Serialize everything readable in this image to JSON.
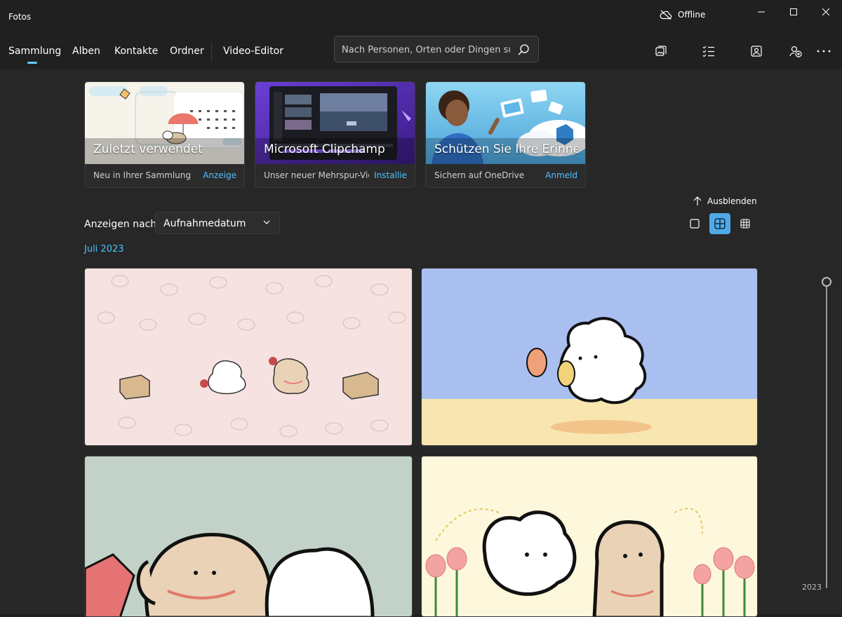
{
  "app": {
    "title": "Fotos",
    "status": "Offline"
  },
  "nav": {
    "tabs": [
      {
        "label": "Sammlung"
      },
      {
        "label": "Alben"
      },
      {
        "label": "Kontakte"
      },
      {
        "label": "Ordner"
      },
      {
        "label": "Video-Editor"
      }
    ],
    "active_tab": "Sammlung"
  },
  "search": {
    "placeholder": "Nach Personen, Orten oder Dingen su"
  },
  "toolbar": {
    "icons": [
      "import-icon",
      "select-icon",
      "people-icon",
      "onedrive-add-icon",
      "more-icon"
    ]
  },
  "cards": [
    {
      "title": "Zuletzt verwendet",
      "subtitle": "Neu in Ihrer Sammlung",
      "action": "Anzeige"
    },
    {
      "title": "Microsoft Clipchamp",
      "subtitle": "Unser neuer Mehrspur-Vid...",
      "action": "Installie"
    },
    {
      "title": "Schützen Sie Ihre Erinne...",
      "subtitle": "Sichern auf OneDrive",
      "action": "Anmeld"
    }
  ],
  "hide": {
    "label": "Ausblenden"
  },
  "sort": {
    "label": "Anzeigen nach:",
    "value": "Aufnahmedatum"
  },
  "view": {
    "active": "medium",
    "options": [
      "large",
      "medium",
      "small"
    ]
  },
  "gallery": {
    "month": "Juli 2023"
  },
  "timeline": {
    "year": "2023"
  },
  "colors": {
    "accent": "#60cdff",
    "link": "#4cc2ff",
    "active_view": "#4fa9e8"
  }
}
